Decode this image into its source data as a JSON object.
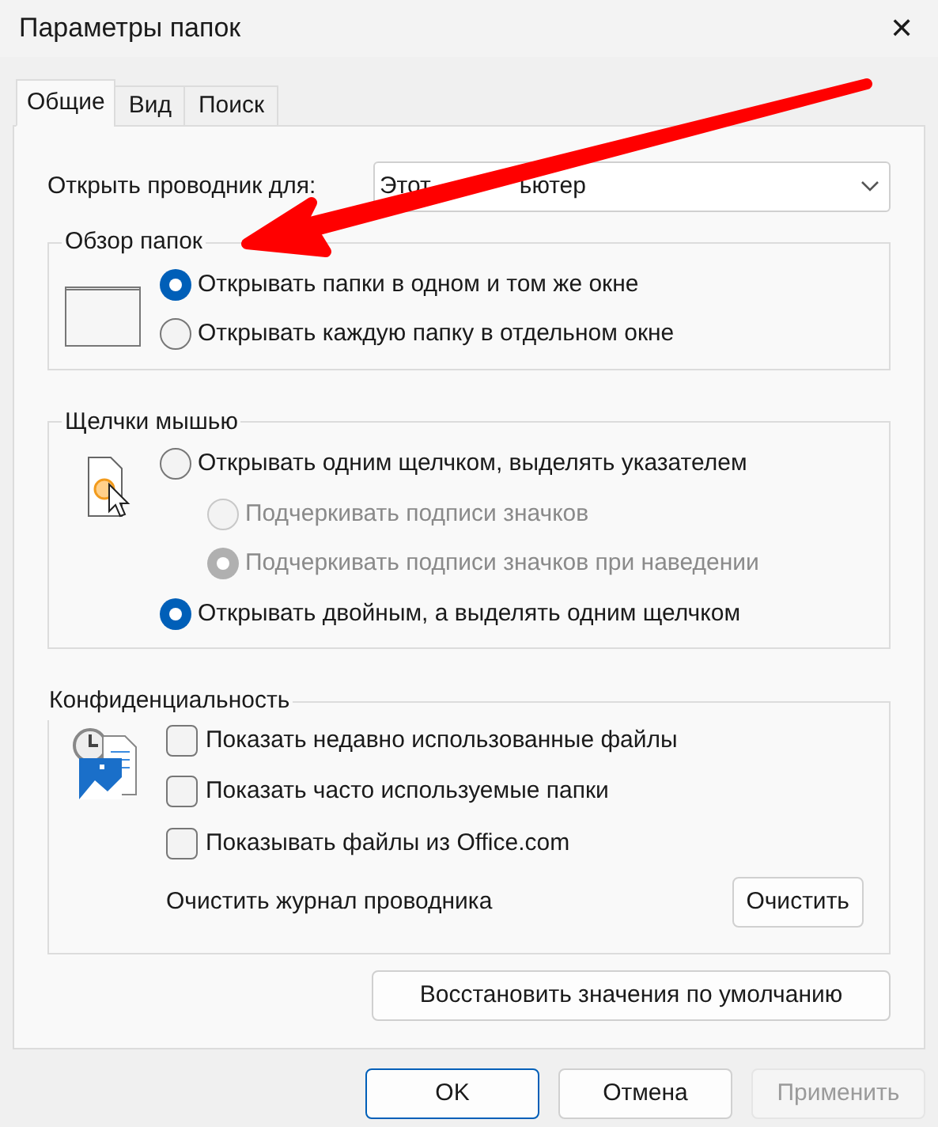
{
  "window": {
    "title": "Параметры папок",
    "close": "✕"
  },
  "tabs": [
    {
      "label": "Общие",
      "selected": true
    },
    {
      "label": "Вид",
      "selected": false
    },
    {
      "label": "Поиск",
      "selected": false
    }
  ],
  "open_explorer": {
    "label": "Открыть проводник для:",
    "value_parts": [
      "Этот",
      "ьютер"
    ]
  },
  "browse_folders": {
    "title": "Обзор папок",
    "options": [
      {
        "label": "Открывать папки в одном и том же окне",
        "selected": true,
        "disabled": false
      },
      {
        "label": "Открывать каждую папку в отдельном окне",
        "selected": false,
        "disabled": false
      }
    ]
  },
  "mouse_clicks": {
    "title": "Щелчки мышью",
    "options": [
      {
        "label": "Открывать одним щелчком, выделять указателем",
        "selected": false,
        "disabled": false,
        "children": [
          {
            "label": "Подчеркивать подписи значков",
            "selected": false,
            "disabled": true
          },
          {
            "label": "Подчеркивать подписи значков при наведении",
            "selected": true,
            "disabled": true
          }
        ]
      },
      {
        "label": "Открывать двойным, а выделять одним щелчком",
        "selected": true,
        "disabled": false
      }
    ]
  },
  "privacy": {
    "title": "Конфиденциальность",
    "checkboxes": [
      {
        "label": "Показать недавно использованные файлы",
        "checked": false
      },
      {
        "label": "Показать часто используемые папки",
        "checked": false
      },
      {
        "label": "Показывать файлы из Office.com",
        "checked": false
      }
    ],
    "clear_label": "Очистить журнал проводника",
    "clear_button": "Очистить"
  },
  "restore_button": "Восстановить значения по умолчанию",
  "buttons": [
    {
      "label": "OK",
      "default": true,
      "disabled": false
    },
    {
      "label": "Отмена",
      "default": false,
      "disabled": false
    },
    {
      "label": "Применить",
      "default": false,
      "disabled": true
    }
  ]
}
